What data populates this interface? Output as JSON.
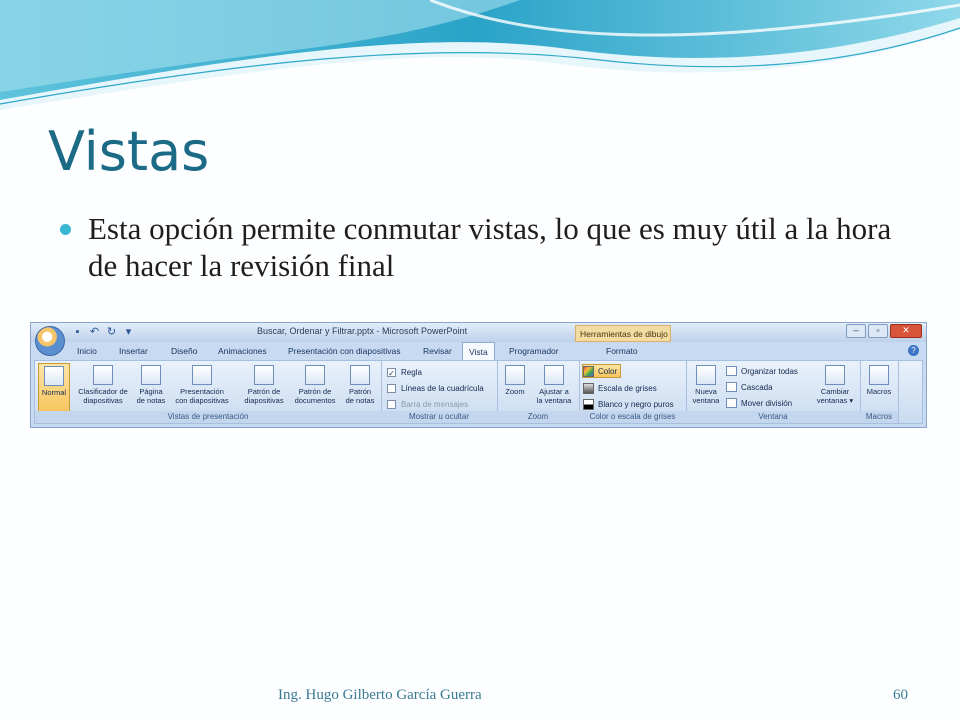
{
  "slide": {
    "title": "Vistas",
    "bullet": "Esta opción permite conmutar vistas, lo que es muy útil a la hora de hacer la revisión final",
    "footer": "Ing. Hugo Gilberto García Guerra",
    "page_number": "60",
    "colors": {
      "title": "#1b6b86",
      "bullet_dot": "#3ab7d3",
      "footer": "#3b7a93"
    }
  },
  "ribbon": {
    "window_title": "Buscar, Ordenar y Filtrar.pptx - Microsoft PowerPoint",
    "contextual_tab": "Herramientas de dibujo",
    "quick_access": [
      "save-icon",
      "undo-icon",
      "redo-icon",
      "customize-icon"
    ],
    "window_controls": [
      "minimize-icon",
      "restore-icon",
      "close-icon"
    ],
    "tabs": [
      "Inicio",
      "Insertar",
      "Diseño",
      "Animaciones",
      "Presentación con diapositivas",
      "Revisar",
      "Vista",
      "Programador",
      "Formato"
    ],
    "active_tab": "Vista",
    "groups": {
      "vistas": {
        "label": "Vistas de presentación",
        "buttons": [
          {
            "label": "Normal"
          },
          {
            "label1": "Clasificador de",
            "label2": "diapositivas"
          },
          {
            "label1": "Página",
            "label2": "de notas"
          },
          {
            "label1": "Presentación",
            "label2": "con diapositivas"
          },
          {
            "label1": "Patrón de",
            "label2": "diapositivas"
          },
          {
            "label1": "Patrón de",
            "label2": "documentos"
          },
          {
            "label1": "Patrón",
            "label2": "de notas"
          }
        ]
      },
      "mostrar": {
        "label": "Mostrar u ocultar",
        "items": [
          "Regla",
          "Líneas de la cuadrícula",
          "Barra de mensajes"
        ]
      },
      "zoom": {
        "label": "Zoom",
        "buttons": [
          {
            "label": "Zoom"
          },
          {
            "label1": "Ajustar a",
            "label2": "la ventana"
          }
        ]
      },
      "color": {
        "label": "Color o escala de grises",
        "items": [
          "Color",
          "Escala de grises",
          "Blanco y negro puros"
        ]
      },
      "ventana": {
        "label": "Ventana",
        "new_window": {
          "label1": "Nueva",
          "label2": "ventana"
        },
        "items": [
          "Organizar todas",
          "Cascada",
          "Mover división"
        ],
        "switch": {
          "label1": "Cambiar",
          "label2": "ventanas ▾"
        }
      },
      "macros": {
        "label": "Macros",
        "button": "Macros"
      }
    }
  }
}
